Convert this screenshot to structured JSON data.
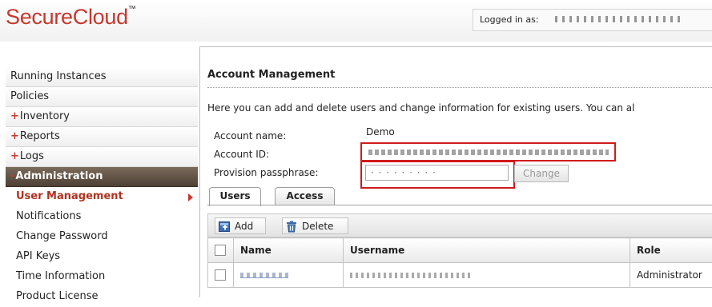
{
  "app": {
    "logo": "SecureCloud",
    "trademark": "™"
  },
  "header": {
    "logged_in_label": "Logged in as:"
  },
  "sidebar": {
    "items": [
      {
        "label": "Running Instances",
        "prefix": ""
      },
      {
        "label": "Policies",
        "prefix": ""
      },
      {
        "label": "Inventory",
        "prefix": "+"
      },
      {
        "label": "Reports",
        "prefix": "+"
      },
      {
        "label": "Logs",
        "prefix": "+"
      },
      {
        "label": "Administration",
        "prefix": "-"
      }
    ],
    "subitems": [
      {
        "label": "User Management"
      },
      {
        "label": "Notifications"
      },
      {
        "label": "Change Password"
      },
      {
        "label": "API Keys"
      },
      {
        "label": "Time Information"
      },
      {
        "label": "Product License"
      }
    ]
  },
  "main": {
    "title": "Account Management",
    "intro": "Here you can add and delete users and change information for existing users. You can al",
    "account_name_label": "Account name:",
    "account_name_value": "Demo",
    "account_id_label": "Account ID:",
    "passphrase_label": "Provision passphrase:",
    "change_button": "Change",
    "tabs": [
      {
        "label": "Users"
      },
      {
        "label": "Access"
      }
    ],
    "toolbar": {
      "add": "Add",
      "delete": "Delete"
    },
    "table": {
      "columns": [
        "Name",
        "Username",
        "Role"
      ],
      "rows": [
        {
          "role": "Administrator"
        }
      ]
    }
  },
  "colors": {
    "brand_red": "#c8372d",
    "highlight_red": "#d21a1a",
    "active_nav": "#5a4a3d"
  }
}
